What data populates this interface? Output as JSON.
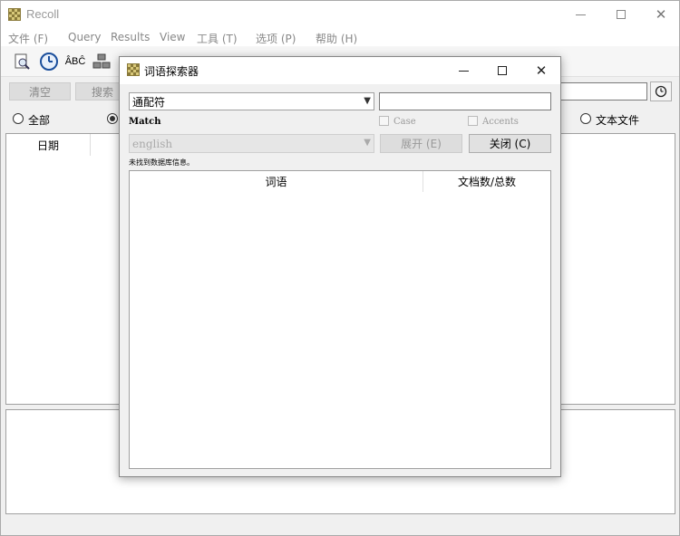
{
  "main_window": {
    "title": "Recoll",
    "menu": [
      "文件 (F)",
      "Query",
      "Results",
      "View",
      "工具 (T)",
      "选项 (P)",
      "帮助 (H)"
    ],
    "toolbar": {
      "spell_label": "ÂBĈ"
    },
    "buttons": {
      "clear": "清空",
      "search": "搜索"
    },
    "filters": {
      "all": "全部",
      "text_files": "文本文件"
    },
    "results_table": {
      "columns": [
        "日期"
      ]
    }
  },
  "dialog": {
    "title": "词语探索器",
    "mode_select": {
      "value": "通配符"
    },
    "term_input": {
      "value": ""
    },
    "match_label": "Match",
    "case_label": "Case",
    "accents_label": "Accents",
    "language_select": {
      "value": "english"
    },
    "expand_button": "展开 (E)",
    "close_button": "关闭 (C)",
    "status_text": "未找到数据库信息。",
    "table": {
      "columns": [
        "词语",
        "文档数/总数"
      ],
      "rows": []
    }
  }
}
